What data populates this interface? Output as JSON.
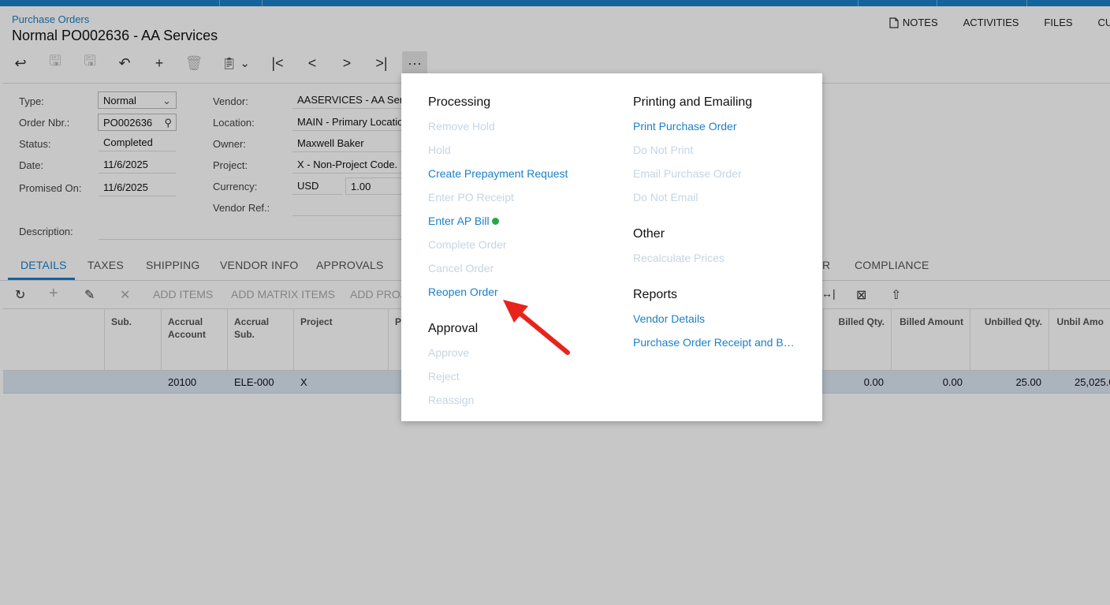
{
  "header": {
    "breadcrumb": "Purchase Orders",
    "title": "Normal PO002636 - AA Services",
    "links": [
      "NOTES",
      "ACTIVITIES",
      "FILES",
      "CUS"
    ]
  },
  "form": {
    "type_label": "Type:",
    "type_value": "Normal",
    "order_label": "Order Nbr.:",
    "order_value": "PO002636",
    "status_label": "Status:",
    "status_value": "Completed",
    "date_label": "Date:",
    "date_value": "11/6/2025",
    "promised_label": "Promised On:",
    "promised_value": "11/6/2025",
    "description_label": "Description:",
    "vendor_label": "Vendor:",
    "vendor_value": "AASERVICES - AA Ser",
    "location_label": "Location:",
    "location_value": "MAIN - Primary Locatio",
    "owner_label": "Owner:",
    "owner_value": "Maxwell Baker",
    "project_label": "Project:",
    "project_value": "X - Non-Project Code.",
    "currency_label": "Currency:",
    "currency_value": "USD",
    "rate_value": "1.00",
    "vendor_ref_label": "Vendor Ref.:"
  },
  "tabs": [
    "DETAILS",
    "TAXES",
    "SHIPPING",
    "VENDOR INFO",
    "APPROVALS",
    "R",
    "COMPLIANCE"
  ],
  "grid_toolbar": {
    "add_items": "ADD ITEMS",
    "add_matrix": "ADD MATRIX ITEMS",
    "add_proj": "ADD PROJ"
  },
  "grid": {
    "headers": {
      "sub": "Sub.",
      "accrual_account": "Accrual Account",
      "accrual_sub": "Accrual Sub.",
      "project": "Project",
      "pr": "Pr",
      "billed_qty": "Billed Qty.",
      "billed_amount": "Billed Amount",
      "unbilled_qty": "Unbilled Qty.",
      "unbilled_amount": "Unbil Amo"
    },
    "row": {
      "accrual_account": "20100",
      "accrual_sub": "ELE-000",
      "project": "X",
      "billed_qty": "0.00",
      "billed_amount": "0.00",
      "unbilled_qty": "25.00",
      "unbilled_amount": "25,025.0"
    }
  },
  "menu": {
    "processing": {
      "title": "Processing",
      "items": [
        "Remove Hold",
        "Hold",
        "Create Prepayment Request",
        "Enter PO Receipt",
        "Enter AP Bill",
        "Complete Order",
        "Cancel Order",
        "Reopen Order"
      ]
    },
    "approval": {
      "title": "Approval",
      "items": [
        "Approve",
        "Reject",
        "Reassign"
      ]
    },
    "printing": {
      "title": "Printing and Emailing",
      "items": [
        "Print Purchase Order",
        "Do Not Print",
        "Email Purchase Order",
        "Do Not Email"
      ]
    },
    "other": {
      "title": "Other",
      "items": [
        "Recalculate Prices"
      ]
    },
    "reports": {
      "title": "Reports",
      "items": [
        "Vendor Details",
        "Purchase Order Receipt and B…"
      ]
    }
  },
  "colors": {
    "accent": "#1a7fc9",
    "disabled": "#c5d5e3",
    "arrow": "#e8231c",
    "status_dot": "#27a844"
  }
}
